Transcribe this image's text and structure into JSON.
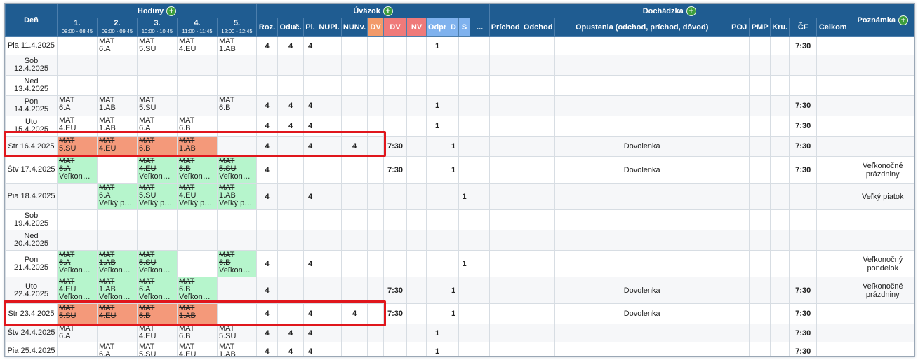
{
  "header": {
    "den": "Deň",
    "hodiny": "Hodiny",
    "uvazok": "Úväzok",
    "dochadzka": "Dochádzka",
    "poznamka": "Poznámka",
    "plus": "+",
    "periods": [
      {
        "n": "1.",
        "t": "08:00 - 08:45"
      },
      {
        "n": "2.",
        "t": "09:00 - 09:45"
      },
      {
        "n": "3.",
        "t": "10:00 - 10:45"
      },
      {
        "n": "4.",
        "t": "11:00 - 11:45"
      },
      {
        "n": "5.",
        "t": "12:00 - 12:45"
      }
    ],
    "uvazok_cols": [
      "Roz.",
      "Oduč.",
      "Pl.",
      "NUPl.",
      "NUNv.",
      "DV",
      "DV",
      "NV",
      "Odpr",
      "D",
      "S",
      "..."
    ],
    "dochadzka_cols": [
      "Príchod",
      "Odchod",
      "Opustenia (odchod, príchod, dôvod)",
      "POJ",
      "PMP",
      "Kru.",
      "ČF",
      "Celkom"
    ]
  },
  "colors": {
    "header_bg": "#1f5c91",
    "dv_orange": "#f29a6a",
    "dv_red": "#ef7a7a",
    "odpr_blue": "#7fb2ee",
    "lesson_cancelled_red": "#f4997a",
    "lesson_holiday_green": "#b6f5cc",
    "highlight_border": "#e0161c"
  },
  "rows": [
    {
      "day": [
        "Pia 11.4.2025"
      ],
      "lessons": [
        {},
        {
          "l1": "MAT",
          "l2": "6.A"
        },
        {
          "l1": "MAT",
          "l2": "5.SU"
        },
        {
          "l1": "MAT",
          "l2": "4.EU"
        },
        {
          "l1": "MAT",
          "l2": "1.AB"
        }
      ],
      "roz": "4",
      "oduc": "4",
      "pl": "4",
      "nupl": "",
      "nunv": "",
      "dvo": "",
      "dvr": "",
      "nv": "",
      "odpr": "1",
      "d": "",
      "s": "",
      "etc": "",
      "prichod": "",
      "odchod": "",
      "opustenia": "",
      "poj": "",
      "pmp": "",
      "kru": "",
      "cf": "7:30",
      "celkom": "",
      "note": ""
    },
    {
      "day": [
        "Sob",
        "12.4.2025"
      ],
      "lessons": [
        {},
        {},
        {},
        {},
        {}
      ],
      "roz": "",
      "oduc": "",
      "pl": "",
      "nupl": "",
      "nunv": "",
      "dvo": "",
      "dvr": "",
      "nv": "",
      "odpr": "",
      "d": "",
      "s": "",
      "etc": "",
      "prichod": "",
      "odchod": "",
      "opustenia": "",
      "poj": "",
      "pmp": "",
      "kru": "",
      "cf": "",
      "celkom": "",
      "note": ""
    },
    {
      "day": [
        "Ned",
        "13.4.2025"
      ],
      "lessons": [
        {},
        {},
        {},
        {},
        {}
      ],
      "roz": "",
      "oduc": "",
      "pl": "",
      "nupl": "",
      "nunv": "",
      "dvo": "",
      "dvr": "",
      "nv": "",
      "odpr": "",
      "d": "",
      "s": "",
      "etc": "",
      "prichod": "",
      "odchod": "",
      "opustenia": "",
      "poj": "",
      "pmp": "",
      "kru": "",
      "cf": "",
      "celkom": "",
      "note": ""
    },
    {
      "day": [
        "Pon",
        "14.4.2025"
      ],
      "lessons": [
        {
          "l1": "MAT",
          "l2": "6.A"
        },
        {
          "l1": "MAT",
          "l2": "1.AB"
        },
        {
          "l1": "MAT",
          "l2": "5.SU"
        },
        {},
        {
          "l1": "MAT",
          "l2": "6.B"
        }
      ],
      "roz": "4",
      "oduc": "4",
      "pl": "4",
      "nupl": "",
      "nunv": "",
      "dvo": "",
      "dvr": "",
      "nv": "",
      "odpr": "1",
      "d": "",
      "s": "",
      "etc": "",
      "prichod": "",
      "odchod": "",
      "opustenia": "",
      "poj": "",
      "pmp": "",
      "kru": "",
      "cf": "7:30",
      "celkom": "",
      "note": ""
    },
    {
      "day": [
        "Uto",
        "15.4.2025"
      ],
      "lessons": [
        {
          "l1": "MAT",
          "l2": "4.EU"
        },
        {
          "l1": "MAT",
          "l2": "1.AB"
        },
        {
          "l1": "MAT",
          "l2": "6.A"
        },
        {
          "l1": "MAT",
          "l2": "6.B"
        },
        {}
      ],
      "roz": "4",
      "oduc": "4",
      "pl": "4",
      "nupl": "",
      "nunv": "",
      "dvo": "",
      "dvr": "",
      "nv": "",
      "odpr": "1",
      "d": "",
      "s": "",
      "etc": "",
      "prichod": "",
      "odchod": "",
      "opustenia": "",
      "poj": "",
      "pmp": "",
      "kru": "",
      "cf": "7:30",
      "celkom": "",
      "note": ""
    },
    {
      "day": [
        "Str 16.4.2025"
      ],
      "lessons": [
        {
          "l1": "MAT",
          "l2": "5.SU",
          "st": "red"
        },
        {
          "l1": "MAT",
          "l2": "4.EU",
          "st": "red"
        },
        {
          "l1": "MAT",
          "l2": "6.B",
          "st": "red"
        },
        {
          "l1": "MAT",
          "l2": "1.AB",
          "st": "red"
        },
        {}
      ],
      "roz": "4",
      "oduc": "",
      "pl": "4",
      "nupl": "",
      "nunv": "4",
      "dvo": "",
      "dvr": "7:30",
      "nv": "",
      "odpr": "",
      "d": "1",
      "s": "",
      "etc": "",
      "prichod": "",
      "odchod": "",
      "opustenia": "Dovolenka",
      "poj": "",
      "pmp": "",
      "kru": "",
      "cf": "7:30",
      "celkom": "",
      "note": ""
    },
    {
      "day": [
        "Štv 17.4.2025"
      ],
      "lessons": [
        {
          "l1": "MAT",
          "l2": "6.A",
          "l3": "Veľkon…",
          "st": "green"
        },
        {},
        {
          "l1": "MAT",
          "l2": "4.EU",
          "l3": "Veľkon…",
          "st": "green"
        },
        {
          "l1": "MAT",
          "l2": "6.B",
          "l3": "Veľkon…",
          "st": "green"
        },
        {
          "l1": "MAT",
          "l2": "5.SU",
          "l3": "Veľkon…",
          "st": "green"
        }
      ],
      "roz": "4",
      "oduc": "",
      "pl": "",
      "nupl": "",
      "nunv": "",
      "dvo": "",
      "dvr": "7:30",
      "nv": "",
      "odpr": "",
      "d": "1",
      "s": "",
      "etc": "",
      "prichod": "",
      "odchod": "",
      "opustenia": "Dovolenka",
      "poj": "",
      "pmp": "",
      "kru": "",
      "cf": "7:30",
      "celkom": "",
      "note": [
        "Veľkonočné",
        "prázdniny"
      ]
    },
    {
      "day": [
        "Pia 18.4.2025"
      ],
      "lessons": [
        {},
        {
          "l1": "MAT",
          "l2": "6.A",
          "l3": "Veľký p…",
          "st": "green"
        },
        {
          "l1": "MAT",
          "l2": "5.SU",
          "l3": "Veľký p…",
          "st": "green"
        },
        {
          "l1": "MAT",
          "l2": "4.EU",
          "l3": "Veľký p…",
          "st": "green"
        },
        {
          "l1": "MAT",
          "l2": "1.AB",
          "l3": "Veľký p…",
          "st": "green"
        }
      ],
      "roz": "4",
      "oduc": "",
      "pl": "4",
      "nupl": "",
      "nunv": "",
      "dvo": "",
      "dvr": "",
      "nv": "",
      "odpr": "",
      "d": "",
      "s": "1",
      "etc": "",
      "prichod": "",
      "odchod": "",
      "opustenia": "",
      "poj": "",
      "pmp": "",
      "kru": "",
      "cf": "",
      "celkom": "",
      "note": [
        "Veľký piatok"
      ]
    },
    {
      "day": [
        "Sob",
        "19.4.2025"
      ],
      "lessons": [
        {},
        {},
        {},
        {},
        {}
      ],
      "roz": "",
      "oduc": "",
      "pl": "",
      "nupl": "",
      "nunv": "",
      "dvo": "",
      "dvr": "",
      "nv": "",
      "odpr": "",
      "d": "",
      "s": "",
      "etc": "",
      "prichod": "",
      "odchod": "",
      "opustenia": "",
      "poj": "",
      "pmp": "",
      "kru": "",
      "cf": "",
      "celkom": "",
      "note": ""
    },
    {
      "day": [
        "Ned",
        "20.4.2025"
      ],
      "lessons": [
        {},
        {},
        {},
        {},
        {}
      ],
      "roz": "",
      "oduc": "",
      "pl": "",
      "nupl": "",
      "nunv": "",
      "dvo": "",
      "dvr": "",
      "nv": "",
      "odpr": "",
      "d": "",
      "s": "",
      "etc": "",
      "prichod": "",
      "odchod": "",
      "opustenia": "",
      "poj": "",
      "pmp": "",
      "kru": "",
      "cf": "",
      "celkom": "",
      "note": ""
    },
    {
      "day": [
        "Pon",
        "21.4.2025"
      ],
      "lessons": [
        {
          "l1": "MAT",
          "l2": "6.A",
          "l3": "Veľkon…",
          "st": "green"
        },
        {
          "l1": "MAT",
          "l2": "1.AB",
          "l3": "Veľkon…",
          "st": "green"
        },
        {
          "l1": "MAT",
          "l2": "5.SU",
          "l3": "Veľkon…",
          "st": "green"
        },
        {},
        {
          "l1": "MAT",
          "l2": "6.B",
          "l3": "Veľkon…",
          "st": "green"
        }
      ],
      "roz": "4",
      "oduc": "",
      "pl": "4",
      "nupl": "",
      "nunv": "",
      "dvo": "",
      "dvr": "",
      "nv": "",
      "odpr": "",
      "d": "",
      "s": "1",
      "etc": "",
      "prichod": "",
      "odchod": "",
      "opustenia": "",
      "poj": "",
      "pmp": "",
      "kru": "",
      "cf": "",
      "celkom": "",
      "note": [
        "Veľkonočný",
        "pondelok"
      ]
    },
    {
      "day": [
        "Uto",
        "22.4.2025"
      ],
      "lessons": [
        {
          "l1": "MAT",
          "l2": "4.EU",
          "l3": "Veľkon…",
          "st": "green"
        },
        {
          "l1": "MAT",
          "l2": "1.AB",
          "l3": "Veľkon…",
          "st": "green"
        },
        {
          "l1": "MAT",
          "l2": "6.A",
          "l3": "Veľkon…",
          "st": "green"
        },
        {
          "l1": "MAT",
          "l2": "6.B",
          "l3": "Veľkon…",
          "st": "green"
        },
        {}
      ],
      "roz": "4",
      "oduc": "",
      "pl": "",
      "nupl": "",
      "nunv": "",
      "dvo": "",
      "dvr": "7:30",
      "nv": "",
      "odpr": "",
      "d": "1",
      "s": "",
      "etc": "",
      "prichod": "",
      "odchod": "",
      "opustenia": "Dovolenka",
      "poj": "",
      "pmp": "",
      "kru": "",
      "cf": "7:30",
      "celkom": "",
      "note": [
        "Veľkonočné",
        "prázdniny"
      ]
    },
    {
      "day": [
        "Str 23.4.2025"
      ],
      "lessons": [
        {
          "l1": "MAT",
          "l2": "5.SU",
          "st": "red"
        },
        {
          "l1": "MAT",
          "l2": "4.EU",
          "st": "red"
        },
        {
          "l1": "MAT",
          "l2": "6.B",
          "st": "red"
        },
        {
          "l1": "MAT",
          "l2": "1.AB",
          "st": "red"
        },
        {}
      ],
      "roz": "4",
      "oduc": "",
      "pl": "4",
      "nupl": "",
      "nunv": "4",
      "dvo": "",
      "dvr": "7:30",
      "nv": "",
      "odpr": "",
      "d": "1",
      "s": "",
      "etc": "",
      "prichod": "",
      "odchod": "",
      "opustenia": "Dovolenka",
      "poj": "",
      "pmp": "",
      "kru": "",
      "cf": "7:30",
      "celkom": "",
      "note": ""
    },
    {
      "day": [
        "Štv 24.4.2025"
      ],
      "lessons": [
        {
          "l1": "MAT",
          "l2": "6.A"
        },
        {},
        {
          "l1": "MAT",
          "l2": "4.EU"
        },
        {
          "l1": "MAT",
          "l2": "6.B"
        },
        {
          "l1": "MAT",
          "l2": "5.SU"
        }
      ],
      "roz": "4",
      "oduc": "4",
      "pl": "4",
      "nupl": "",
      "nunv": "",
      "dvo": "",
      "dvr": "",
      "nv": "",
      "odpr": "1",
      "d": "",
      "s": "",
      "etc": "",
      "prichod": "",
      "odchod": "",
      "opustenia": "",
      "poj": "",
      "pmp": "",
      "kru": "",
      "cf": "7:30",
      "celkom": "",
      "note": ""
    },
    {
      "day": [
        "Pia 25.4.2025"
      ],
      "lessons": [
        {},
        {
          "l1": "MAT",
          "l2": "6.A"
        },
        {
          "l1": "MAT",
          "l2": "5.SU"
        },
        {
          "l1": "MAT",
          "l2": "4.EU"
        },
        {
          "l1": "MAT",
          "l2": "1.AB"
        }
      ],
      "roz": "4",
      "oduc": "4",
      "pl": "4",
      "nupl": "",
      "nunv": "",
      "dvo": "",
      "dvr": "",
      "nv": "",
      "odpr": "1",
      "d": "",
      "s": "",
      "etc": "",
      "prichod": "",
      "odchod": "",
      "opustenia": "",
      "poj": "",
      "pmp": "",
      "kru": "",
      "cf": "7:30",
      "celkom": "",
      "note": ""
    }
  ]
}
